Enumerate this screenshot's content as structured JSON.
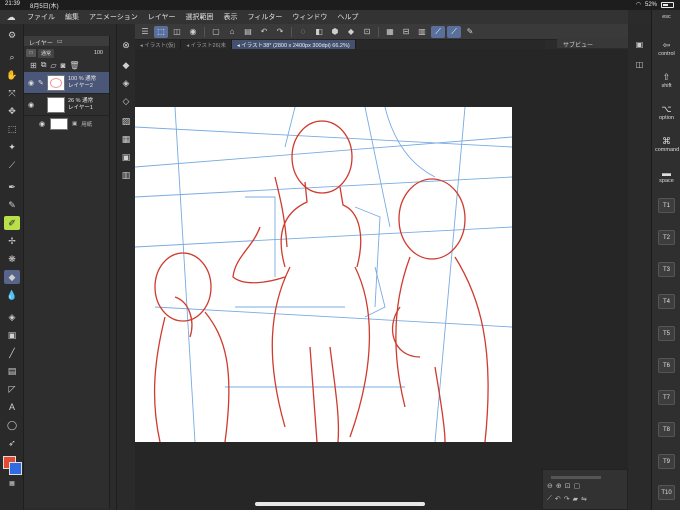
{
  "status": {
    "time": "21:39",
    "date": "8月5日(木)",
    "battery": "52%"
  },
  "menu": [
    "ファイル",
    "編集",
    "アニメーション",
    "レイヤー",
    "選択範囲",
    "表示",
    "フィルター",
    "ウィンドウ",
    "ヘルプ"
  ],
  "tabs": [
    {
      "label": "◂ イラスト(仮)",
      "active": false
    },
    {
      "label": "◂ イラスト26(未",
      "active": false
    },
    {
      "label": "◂ イラスト38* (2800 x 2400px 300dpi) 66.2%)",
      "active": true
    }
  ],
  "subview": {
    "label": "サブビュー"
  },
  "layer_panel": {
    "title": "レイヤー",
    "blend_mode": "通常",
    "opacity": "100",
    "layers": [
      {
        "line1": "100 % 通常",
        "line2": "レイヤー2",
        "selected": true
      },
      {
        "line1": "26 % 通常",
        "line2": "レイヤー1",
        "selected": false
      }
    ],
    "folder": {
      "label": "用紙"
    }
  },
  "shortcuts": {
    "keys": [
      {
        "glyph": "",
        "label": "esc"
      },
      {
        "glyph": "⇦",
        "label": "control"
      },
      {
        "glyph": "⇧",
        "label": "shift"
      },
      {
        "glyph": "⌥",
        "label": "option"
      },
      {
        "glyph": "⌘",
        "label": "command"
      },
      {
        "glyph": "▬",
        "label": "space"
      }
    ],
    "tkeys": [
      "T1",
      "T2",
      "T3",
      "T4",
      "T5",
      "T6",
      "T7",
      "T8",
      "T9",
      "T10"
    ]
  },
  "colors": {
    "main": "#e24b2f",
    "sub": "#2f6ce2",
    "accent": "#58648a"
  }
}
